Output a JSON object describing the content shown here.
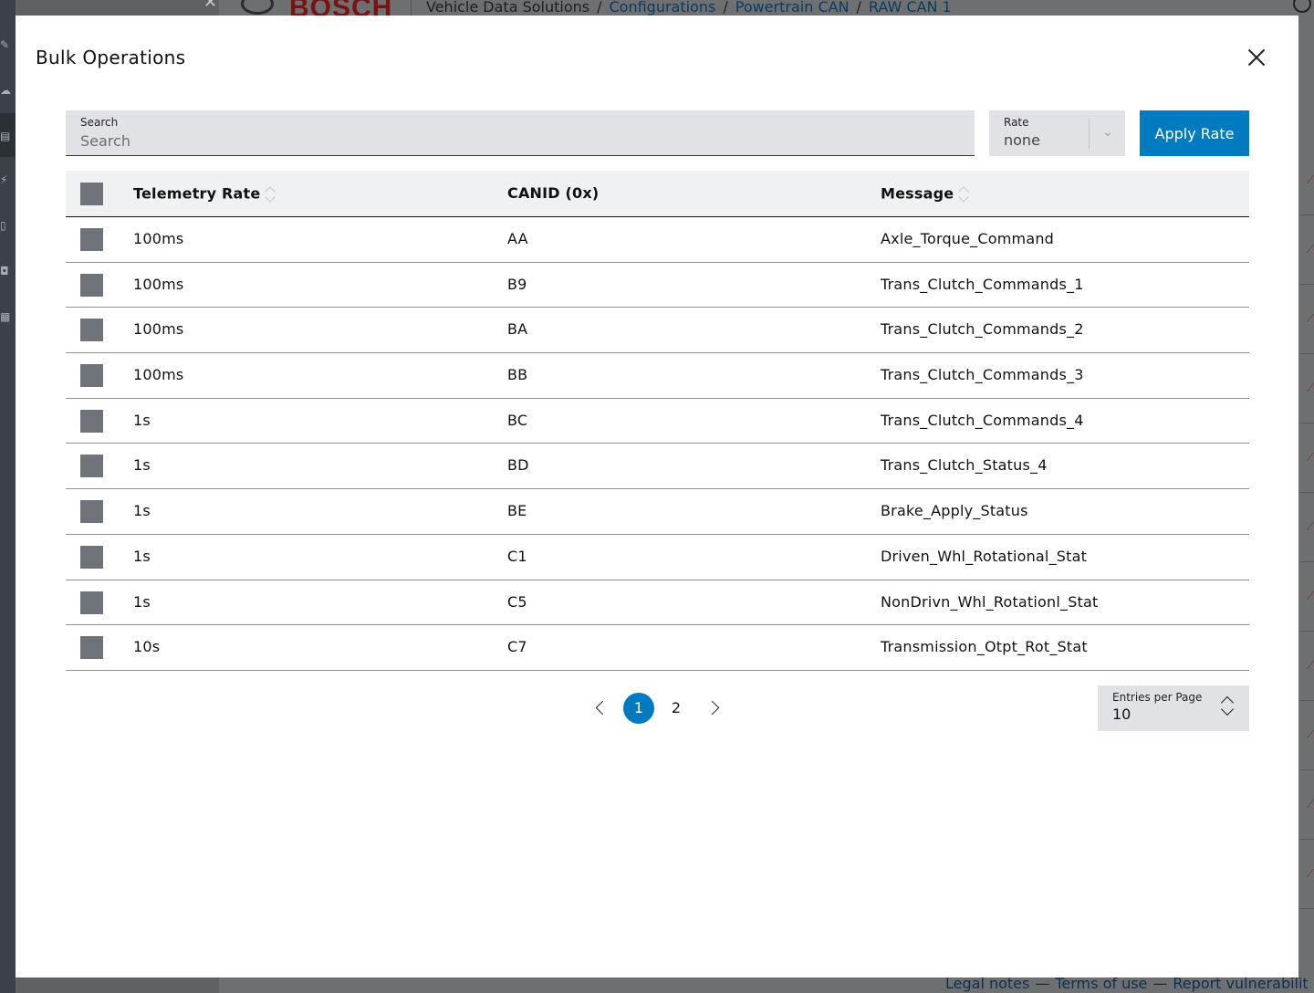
{
  "background": {
    "header": {
      "breadcrumbs": [
        "Vehicle Data Solutions",
        "Configurations",
        "Powertrain CAN",
        "RAW CAN 1"
      ],
      "separator": "/"
    },
    "logo_text": "BOSCH",
    "footer": {
      "legal_notes": "Legal notes",
      "terms_of_use": "Terms of use",
      "report_vulnerability": "Report vulnerabilit"
    }
  },
  "modal": {
    "title": "Bulk Operations",
    "search": {
      "label": "Search",
      "placeholder": "Search",
      "value": ""
    },
    "rate_select": {
      "label": "Rate",
      "value": "none"
    },
    "apply_button": "Apply Rate",
    "table": {
      "columns": [
        "Telemetry Rate",
        "CANID (0x)",
        "Message"
      ],
      "rows": [
        {
          "rate": "100ms",
          "canid": "AA",
          "message": "Axle_Torque_Command"
        },
        {
          "rate": "100ms",
          "canid": "B9",
          "message": "Trans_Clutch_Commands_1"
        },
        {
          "rate": "100ms",
          "canid": "BA",
          "message": "Trans_Clutch_Commands_2"
        },
        {
          "rate": "100ms",
          "canid": "BB",
          "message": "Trans_Clutch_Commands_3"
        },
        {
          "rate": "1s",
          "canid": "BC",
          "message": "Trans_Clutch_Commands_4"
        },
        {
          "rate": "1s",
          "canid": "BD",
          "message": "Trans_Clutch_Status_4"
        },
        {
          "rate": "1s",
          "canid": "BE",
          "message": "Brake_Apply_Status"
        },
        {
          "rate": "1s",
          "canid": "C1",
          "message": "Driven_Whl_Rotational_Stat"
        },
        {
          "rate": "1s",
          "canid": "C5",
          "message": "NonDrivn_Whl_Rotationl_Stat"
        },
        {
          "rate": "10s",
          "canid": "C7",
          "message": "Transmission_Otpt_Rot_Stat"
        }
      ]
    },
    "pagination": {
      "pages": [
        "1",
        "2"
      ],
      "current": "1"
    },
    "entries_per_page": {
      "label": "Entries per Page",
      "value": "10"
    }
  },
  "colors": {
    "accent": "#007bc0",
    "field_bg": "#e0e2e5",
    "header_bg": "#eff1f2",
    "checkbox": "#6d7378"
  }
}
